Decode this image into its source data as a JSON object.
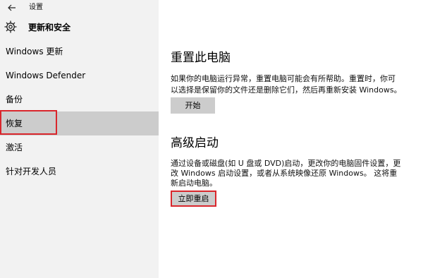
{
  "window": {
    "title": "设置"
  },
  "sidebar": {
    "header": "更新和安全",
    "items": [
      {
        "label": "Windows 更新"
      },
      {
        "label": "Windows Defender"
      },
      {
        "label": "备份"
      },
      {
        "label": "恢复"
      },
      {
        "label": "激活"
      },
      {
        "label": "针对开发人员"
      }
    ],
    "selected_index": 3
  },
  "main": {
    "reset": {
      "title": "重置此电脑",
      "line1": "如果你的电脑运行异常，重置电脑可能会有所帮助。重置时，你可",
      "line2": "以选择是保留你的文件还是删除它们，然后再重新安装 Windows。",
      "button": "开始"
    },
    "advanced": {
      "title": "高级启动",
      "line1": "通过设备或磁盘(如 U 盘或 DVD)启动，更改你的电脑固件设置，更",
      "line2": "改 Windows 启动设置，或者从系统映像还原 Windows。  这将重",
      "line3": "新启动电脑。",
      "button": "立即重启"
    }
  },
  "colors": {
    "sidebar_bg": "#f2f2f2",
    "selected_bg": "#cccccc",
    "button_bg": "#cccccc",
    "annotation_red": "#d9262c"
  }
}
